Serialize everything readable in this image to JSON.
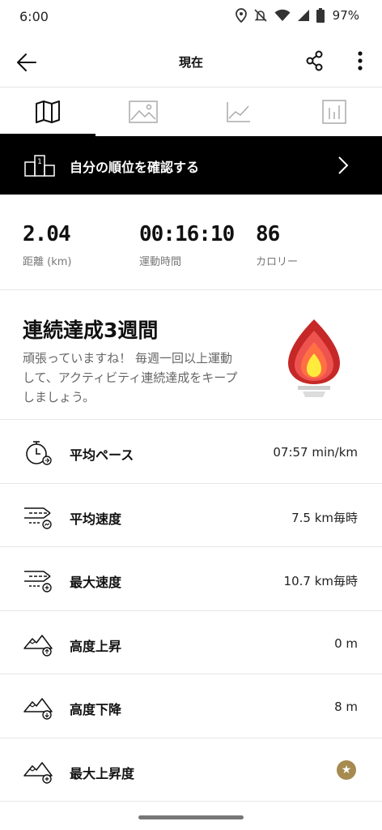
{
  "status_bar": {
    "time": "6:00",
    "battery_percent": "97%",
    "icons": [
      "location-icon",
      "mute-icon",
      "wifi-icon",
      "signal-icon",
      "battery-icon"
    ]
  },
  "header": {
    "title": "現在",
    "back_icon": "back-arrow-icon",
    "share_icon": "share-icon",
    "more_icon": "more-vertical-icon"
  },
  "tabs": [
    {
      "icon": "map-icon",
      "active": true
    },
    {
      "icon": "photo-icon",
      "active": false
    },
    {
      "icon": "line-chart-icon",
      "active": false
    },
    {
      "icon": "bar-chart-icon",
      "active": false
    }
  ],
  "rank_banner": {
    "label": "自分の順位を確認する",
    "rank_digit": "1"
  },
  "summary": {
    "distance": {
      "value": "2.04",
      "label": "距離 (km)"
    },
    "duration": {
      "value": "00:16:10",
      "label": "運動時間"
    },
    "calories": {
      "value": "86",
      "label": "カロリー"
    }
  },
  "streak": {
    "title": "連続達成3週間",
    "description": "頑張っていますね！ 毎週一回以上運動して、アクティビティ連続達成をキープしましょう。"
  },
  "metrics": [
    {
      "icon": "stopwatch-icon",
      "label": "平均ペース",
      "value": "07:57 min/km"
    },
    {
      "icon": "speed-average-icon",
      "label": "平均速度",
      "value": "7.5 km毎時"
    },
    {
      "icon": "speed-max-icon",
      "label": "最大速度",
      "value": "10.7 km毎時"
    },
    {
      "icon": "elevation-gain-icon",
      "label": "高度上昇",
      "value": "0 m"
    },
    {
      "icon": "elevation-loss-icon",
      "label": "高度下降",
      "value": "8 m"
    },
    {
      "icon": "elevation-max-icon",
      "label": "最大上昇度",
      "value": ""
    }
  ],
  "colors": {
    "accent_black": "#000000",
    "premium_gold": "#a68a4f",
    "flame_outer": "#c62828",
    "flame_mid": "#ff5722",
    "flame_inner": "#ffeb3b"
  }
}
